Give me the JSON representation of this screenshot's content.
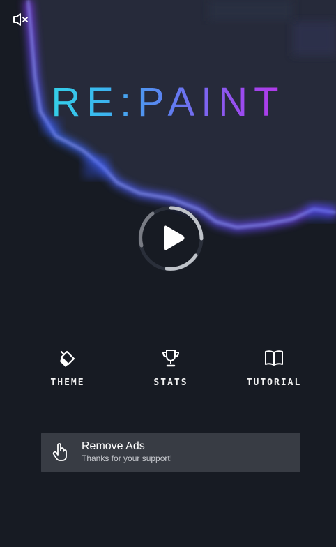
{
  "app": {
    "title": "RE:PAINT"
  },
  "icons": {
    "mute": "speaker-muted-icon",
    "play": "play-icon",
    "theme": "paint-bucket-icon",
    "stats": "trophy-icon",
    "tutorial": "open-book-icon",
    "remove_ads": "tap-hand-icon"
  },
  "menu": {
    "theme_label": "THEME",
    "stats_label": "STATS",
    "tutorial_label": "TUTORIAL"
  },
  "remove_ads": {
    "title": "Remove Ads",
    "subtitle": "Thanks for your support!"
  },
  "colors": {
    "background": "#171b23",
    "blob_fill": "#262a3a",
    "glow_blue": "#3a6bff",
    "glow_purple": "#8a3cff",
    "title_gradient": [
      "#2ee6e0",
      "#5e7ff0",
      "#d21ee0"
    ],
    "button_bg": "#383c44"
  }
}
